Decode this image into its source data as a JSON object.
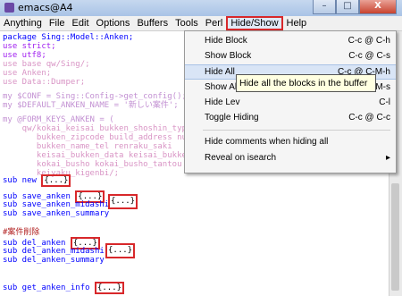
{
  "window": {
    "title": "emacs@A4",
    "minimize": "–",
    "maximize": "□",
    "close": "X"
  },
  "menubar": {
    "items": [
      "Anything",
      "File",
      "Edit",
      "Options",
      "Buffers",
      "Tools",
      "Perl",
      "Hide/Show",
      "Help"
    ]
  },
  "code": {
    "l1": "package Sing::Model::Anken;",
    "l2": "use strict;",
    "l3": "use utf8;",
    "l4": "use base qw/Sing/;",
    "l5": "use Anken;",
    "l6": "use Data::Dumper;",
    "l7": "my $CONF = Sing::Config->get_config();",
    "l8": "my $DEFAULT_ANKEN_NAME = '新しい案件';",
    "l9": "my @FORM_KEYS_ANKEN = (",
    "l10": "    qw/kokai_keisai bukken_shoshin_type ti",
    "l11": "       bukken_zipcode build_address num_floor",
    "l12": "       bukken_name_tel renraku_saki",
    "l13": "       keisai_bukken_data keisai_bukken_data",
    "l14": "       kokai_busho kokai_busho_tantou keiyaku_tantou",
    "l15": "       keiyaku_kigenbi/;",
    "sub_new": "sub new ",
    "sub_save": "sub save_anken ",
    "sub_save_midashi": "sub save_anken_midashi ",
    "sub_save_summary": "sub save_anken_summary ",
    "comment_delete": "#案件削除",
    "sub_del": "sub del_anken ",
    "sub_del_midashi": "sub del_anken_midashi ",
    "sub_del_summary": "sub del_anken_summary ",
    "sub_get_info": "sub get_anken_info ",
    "folded": "{...}"
  },
  "hideshow_menu": {
    "items": [
      {
        "label": "Hide Block",
        "shortcut": "C-c @ C-h"
      },
      {
        "label": "Show Block",
        "shortcut": "C-c @ C-s"
      },
      {
        "label": "Hide All",
        "shortcut": "C-c @ C-M-h"
      },
      {
        "label": "Show All",
        "shortcut": "M-s"
      },
      {
        "label": "Hide Lev",
        "shortcut": "C-l"
      },
      {
        "label": "Toggle Hiding",
        "shortcut": "C-c @ C-c"
      },
      {
        "label": "Hide comments when hiding all",
        "shortcut": ""
      },
      {
        "label": "Reveal on isearch",
        "shortcut": "▸"
      }
    ]
  },
  "tooltip": "Hide all the blocks in the buffer"
}
